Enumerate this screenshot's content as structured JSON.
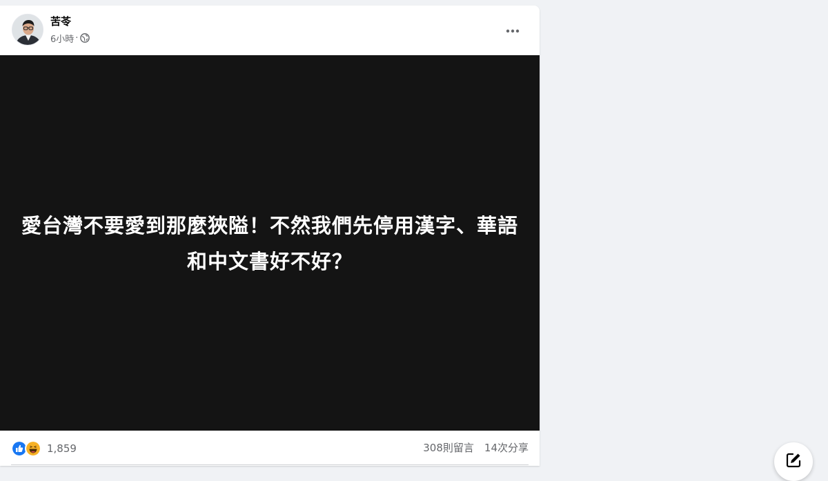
{
  "post": {
    "author_name": "苦苓",
    "timestamp": "6小時",
    "separator": "·",
    "privacy_icon": "globe-icon",
    "more_icon": "more-horizontal-icon",
    "media_text": "愛台灣不要愛到那麼狹隘！不然我們先停用漢字、華語和中文書好不好？"
  },
  "stats": {
    "reactions": [
      "like-reaction-icon",
      "haha-reaction-icon"
    ],
    "reaction_count": "1,859",
    "comments": "308則留言",
    "shares": "14次分享"
  },
  "colors": {
    "media_background": "#141414",
    "like_blue": "#1877f2",
    "secondary_text": "#65676b",
    "page_background": "#f0f2f5"
  },
  "compose_icon": "new-message-icon"
}
